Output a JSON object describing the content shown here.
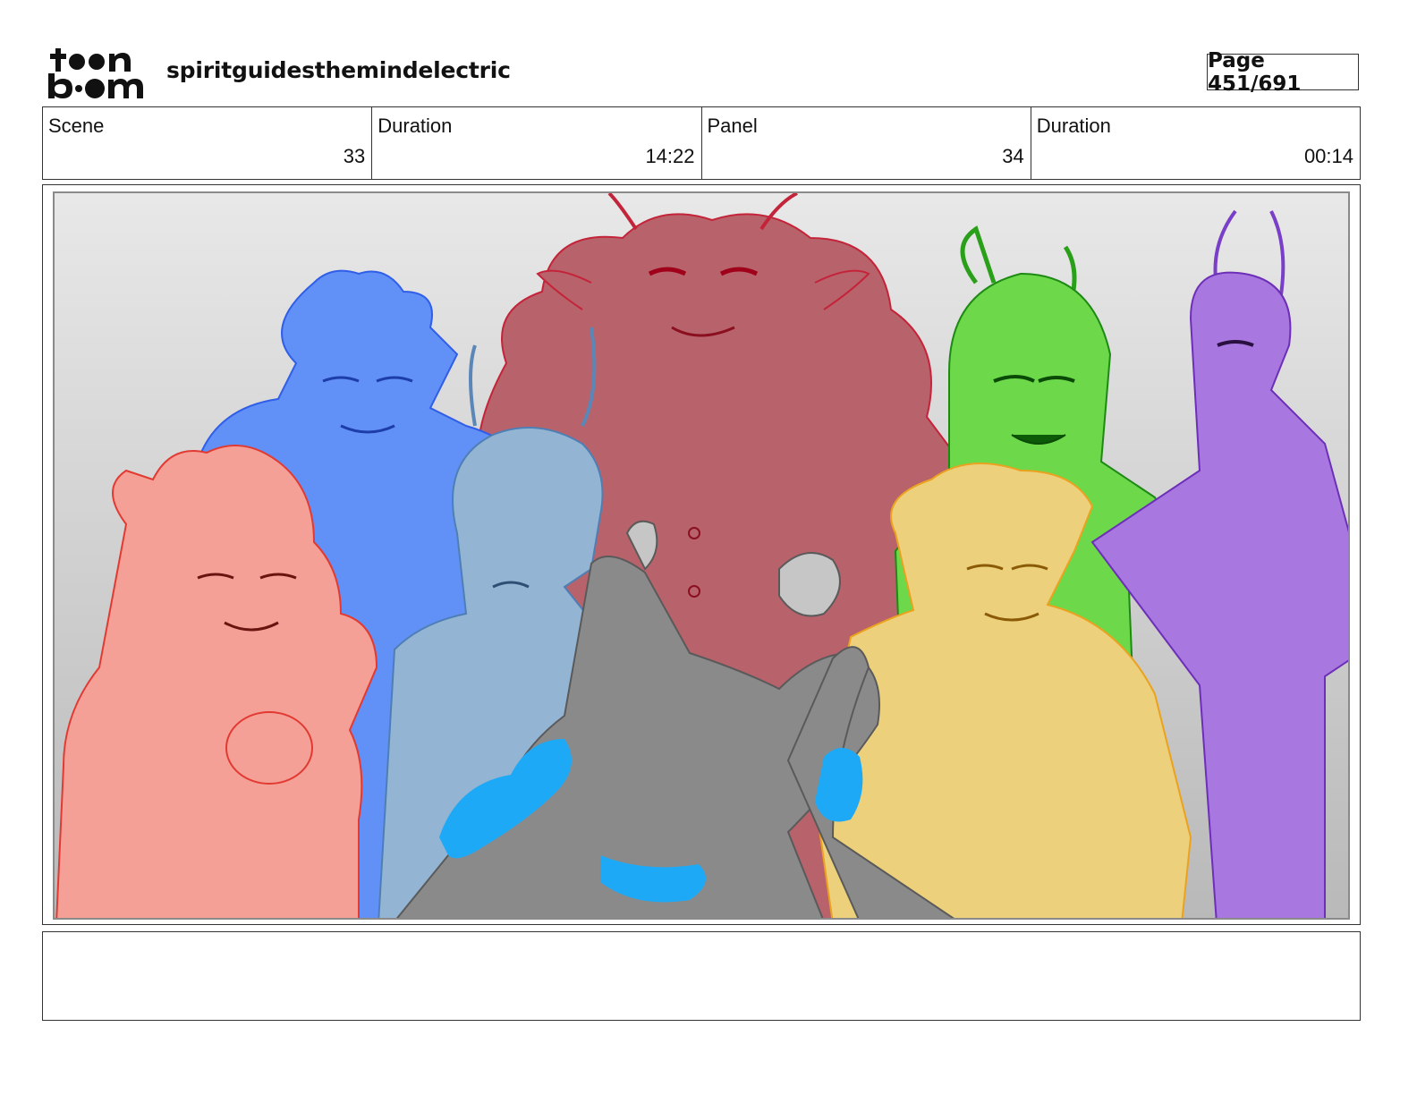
{
  "header": {
    "logo_text": "toon boom",
    "project_title": "spiritguidesthemindelectric",
    "page_label": "Page 451/691"
  },
  "info": {
    "scene_label": "Scene",
    "scene_value": "33",
    "scene_duration_label": "Duration",
    "scene_duration_value": "14:22",
    "panel_label": "Panel",
    "panel_value": "34",
    "panel_duration_label": "Duration",
    "panel_duration_value": "00:14"
  },
  "panel_colors": {
    "red": "#f4a096",
    "blue": "#6190f6",
    "maroon": "#b8636b",
    "light_blue": "#93b4d3",
    "gray": "#8a8a8a",
    "yellow": "#ecd07c",
    "green": "#6cd84a",
    "purple": "#a878e0",
    "cyan": "#1ea9f7"
  }
}
